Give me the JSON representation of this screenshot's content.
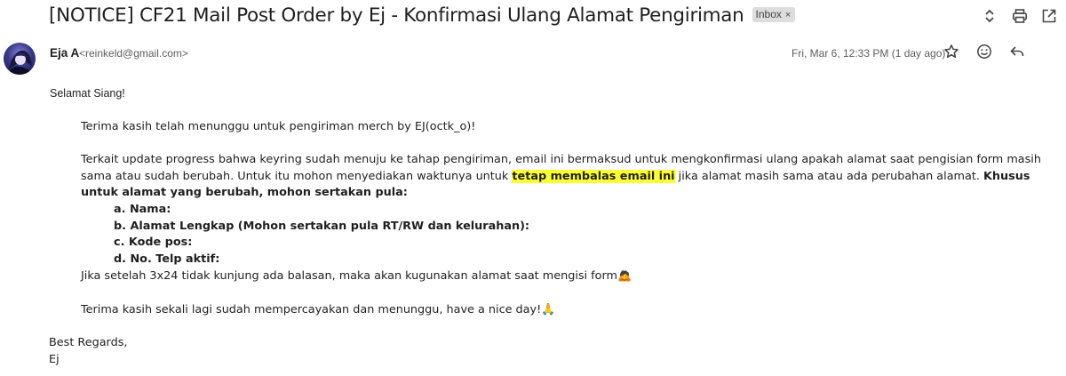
{
  "email": {
    "subject": "[NOTICE] CF21 Mail Post Order by Ej - Konfirmasi Ulang Alamat Pengiriman",
    "label": "Inbox",
    "label_remove": "×",
    "sender_name": "Eja A",
    "sender_email": "<reinkeld@gmail.com>",
    "date": "Fri, Mar 6, 12:33 PM (1 day ago)"
  },
  "icons": {
    "expand": "unfold-icon",
    "print": "print-icon",
    "open_new": "open-in-new-icon",
    "star": "star-icon",
    "react": "emoji-icon",
    "reply": "reply-icon"
  },
  "message": {
    "greeting": "Selamat Siang!",
    "thanks_wait": "Terima kasih telah menunggu untuk pengiriman merch by EJ(octk_o)!",
    "p2_part1": "Terkait update progress bahwa keyring sudah menuju ke tahap pengiriman, email ini bermaksud untuk mengkonfirmasi ulang apakah alamat saat pengisian form masih sama atau sudah berubah. Untuk itu mohon menyediakan waktunya untuk ",
    "p2_highlight": "tetap membalas email ini",
    "p2_part2": " jika alamat masih sama atau ada perubahan alamat. ",
    "p2_bold": "Khusus untuk alamat yang berubah, mohon sertakan pula:",
    "list": [
      "a. Nama:",
      "b. Alamat Lengkap (Mohon sertakan pula RT/RW dan kelurahan):",
      "c. Kode pos:",
      "d. No. Telp aktif:"
    ],
    "deadline": "Jika setelah 3x24 tidak kunjung ada balasan, maka akan kugunakan alamat saat mengisi form🙇",
    "closing": "Terima kasih sekali lagi sudah mempercayakan dan menunggu, have a nice day!🙏",
    "regards": "Best Regards,",
    "signature": "Ej"
  },
  "colors": {
    "highlight": "#ffff33",
    "chip": "#dddddd",
    "text": "#1f1f1f",
    "muted": "#5e5e5e"
  }
}
